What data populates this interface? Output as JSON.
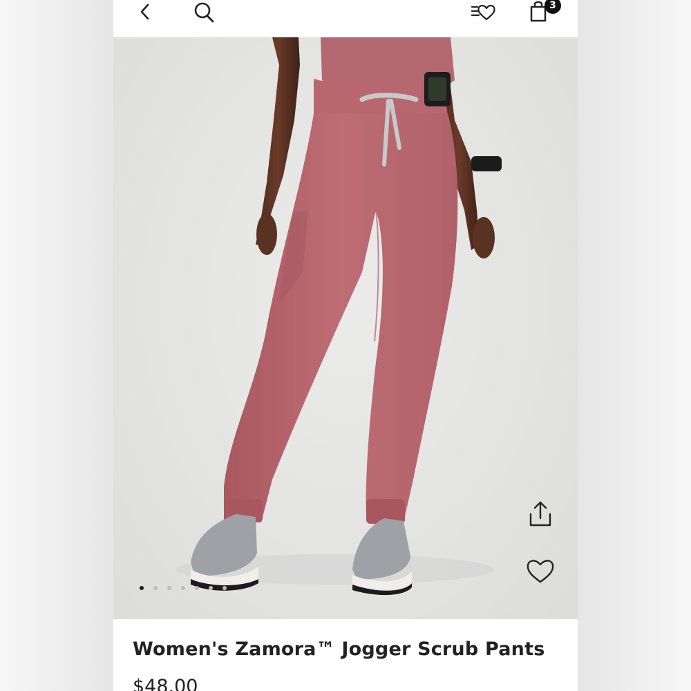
{
  "header": {
    "back_icon": "chevron-left-icon",
    "search_icon": "search-icon",
    "wishlist_icon": "wishlist-list-heart-icon",
    "bag_icon": "shopping-bag-icon",
    "bag_count": "3"
  },
  "gallery": {
    "image_count": 7,
    "active_index": 0,
    "share_icon": "share-icon",
    "favorite_icon": "heart-outline-icon"
  },
  "product": {
    "title": "Women's Zamora™ Jogger Scrub Pants",
    "price": "$48.00"
  },
  "colors": {
    "pants": "#b9696f",
    "accent": "#111111"
  }
}
